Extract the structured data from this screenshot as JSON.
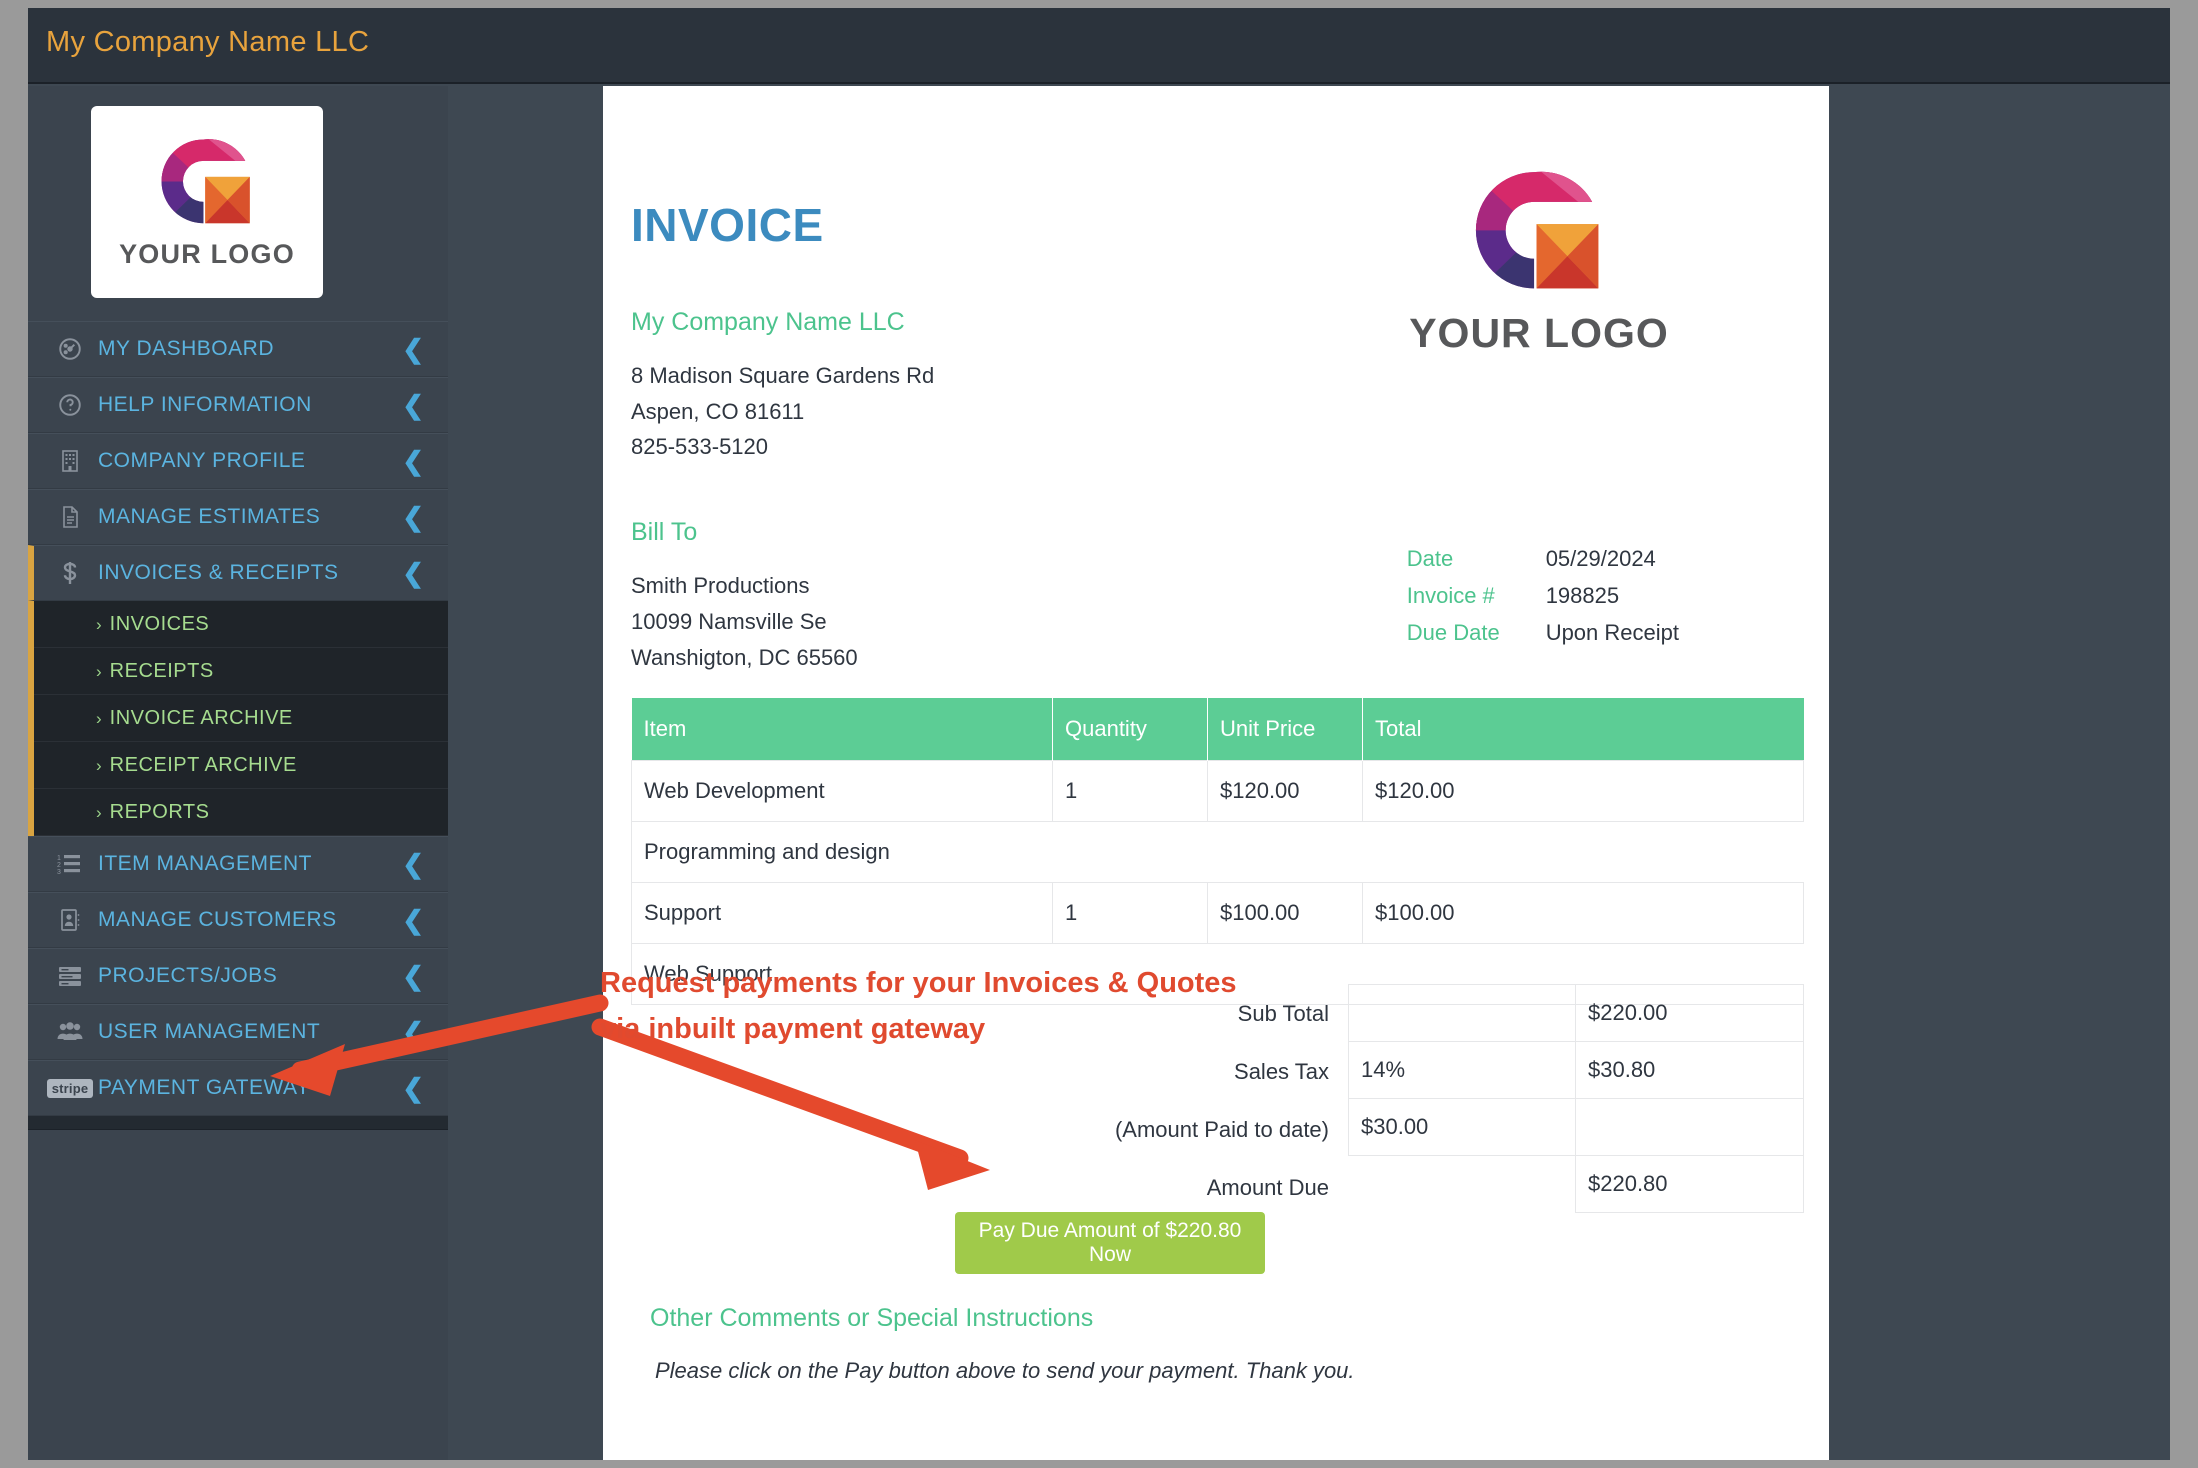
{
  "app": {
    "title": "My Company Name LLC"
  },
  "sidebar": {
    "logo": {
      "word": "YOUR LOGO"
    },
    "items": [
      {
        "label": "MY DASHBOARD",
        "icon": "dashboard-gauge-icon",
        "active": false
      },
      {
        "label": "HELP INFORMATION",
        "icon": "question-circle-icon",
        "active": false
      },
      {
        "label": "COMPANY PROFILE",
        "icon": "building-icon",
        "active": false
      },
      {
        "label": "MANAGE ESTIMATES",
        "icon": "document-lines-icon",
        "active": false
      },
      {
        "label": "INVOICES & RECEIPTS",
        "icon": "dollar-sign-icon",
        "active": true
      },
      {
        "label": "ITEM MANAGEMENT",
        "icon": "numbered-list-icon",
        "active": false
      },
      {
        "label": "MANAGE CUSTOMERS",
        "icon": "address-book-icon",
        "active": false
      },
      {
        "label": "PROJECTS/JOBS",
        "icon": "server-rows-icon",
        "active": false
      },
      {
        "label": "USER MANAGEMENT",
        "icon": "users-group-icon",
        "active": false
      },
      {
        "label": "PAYMENT GATEWAY",
        "icon": "stripe-badge-icon",
        "active": false
      }
    ],
    "submenu": [
      {
        "label": "INVOICES"
      },
      {
        "label": "RECEIPTS"
      },
      {
        "label": "INVOICE ARCHIVE"
      },
      {
        "label": "RECEIPT ARCHIVE"
      },
      {
        "label": "REPORTS"
      }
    ],
    "stripe_badge_text": "stripe",
    "chevron": "❮",
    "sub_chevron": "›"
  },
  "invoice": {
    "heading": "INVOICE",
    "company_name": "My Company Name LLC",
    "company_address_line1": "8 Madison Square Gardens Rd",
    "company_address_line2": "Aspen, CO 81611",
    "company_phone": "825-533-5120",
    "bill_to_label": "Bill To",
    "bill_to_name": "Smith Productions",
    "bill_to_line1": "10099 Namsville Se",
    "bill_to_line2": "Wanshigton, DC 65560",
    "logo_word": "YOUR LOGO",
    "meta": [
      {
        "key": "Date",
        "value": "05/29/2024"
      },
      {
        "key": "Invoice #",
        "value": "198825"
      },
      {
        "key": "Due Date",
        "value": "Upon Receipt"
      }
    ],
    "table": {
      "headers": [
        "Item",
        "Quantity",
        "Unit Price",
        "Total"
      ],
      "rows": [
        {
          "item": "Web Development",
          "quantity": "1",
          "unit_price": "$120.00",
          "total": "$120.00",
          "description": "Programming and design"
        },
        {
          "item": "Support",
          "quantity": "1",
          "unit_price": "$100.00",
          "total": "$100.00",
          "description": "Web Support"
        }
      ]
    },
    "totals": [
      {
        "label": "Sub Total",
        "mid": "",
        "amount": "$220.00"
      },
      {
        "label": "Sales Tax",
        "mid": "14%",
        "amount": "$30.80"
      },
      {
        "label": "(Amount Paid to date)",
        "mid": "$30.00",
        "amount": ""
      },
      {
        "label": "Amount Due",
        "mid": "",
        "amount": "$220.80"
      }
    ],
    "pay_button": "Pay Due Amount of $220.80 Now",
    "comments_heading": "Other Comments or Special Instructions",
    "comments_body": "Please click on the Pay button above to send your payment. Thank you."
  },
  "annotation": {
    "line1": "Request payments for your Invoices & Quotes",
    "line2": "via inbuilt payment gateway",
    "color": "#e04a2f"
  },
  "colors": {
    "accent_orange": "#e8a33d",
    "nav_blue": "#5bb4e0",
    "sub_green": "#a6dc8f",
    "table_header_green": "#5ccd95",
    "pay_button_green": "#a0ca4a",
    "invoice_title_blue": "#3c8bbf",
    "label_green": "#4cc38d"
  }
}
